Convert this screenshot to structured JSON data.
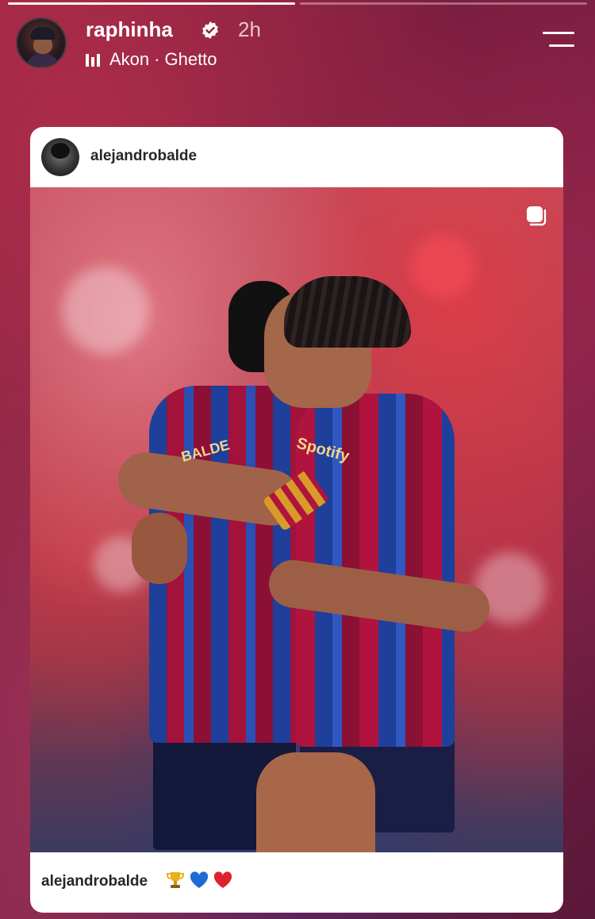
{
  "story": {
    "username": "raphinha",
    "time": "2h",
    "music": {
      "artist": "Akon",
      "separator": "·",
      "track": "Ghetto"
    },
    "progress": [
      1.0,
      0.0
    ],
    "accent_bg": "#7c2348"
  },
  "post_card": {
    "username": "alejandrobalde",
    "photo": {
      "sponsor_text": "Spotify",
      "jersey_name": "BALDE"
    },
    "caption": {
      "username": "alejandrobalde",
      "emojis": [
        "trophy-icon",
        "blue-heart-icon",
        "red-heart-icon"
      ]
    }
  }
}
